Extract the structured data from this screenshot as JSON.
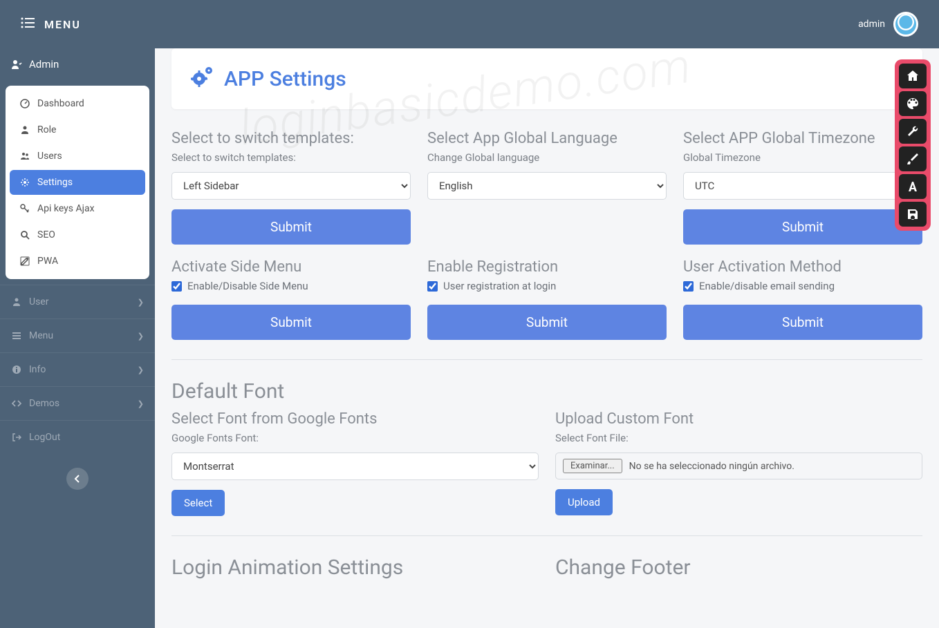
{
  "topbar": {
    "menu_label": "MENU",
    "username": "admin"
  },
  "sidebar": {
    "header": "Admin",
    "admin_items": [
      {
        "icon": "dashboard",
        "label": "Dashboard"
      },
      {
        "icon": "role",
        "label": "Role"
      },
      {
        "icon": "users",
        "label": "Users"
      },
      {
        "icon": "settings",
        "label": "Settings",
        "active": true
      },
      {
        "icon": "key",
        "label": "Api keys Ajax"
      },
      {
        "icon": "search",
        "label": "SEO"
      },
      {
        "icon": "edit",
        "label": "PWA"
      }
    ],
    "sections": [
      {
        "icon": "user",
        "label": "User"
      },
      {
        "icon": "menu",
        "label": "Menu"
      },
      {
        "icon": "info",
        "label": "Info"
      },
      {
        "icon": "code",
        "label": "Demos"
      },
      {
        "icon": "logout",
        "label": "LogOut",
        "no_chev": true
      }
    ]
  },
  "page": {
    "title": "APP Settings"
  },
  "blocks": {
    "template": {
      "title": "Select to switch templates:",
      "sub": "Select to switch templates:",
      "value": "Left Sidebar",
      "submit": "Submit"
    },
    "language": {
      "title": "Select App Global Language",
      "sub": "Change Global language",
      "value": "English"
    },
    "timezone": {
      "title": "Select APP Global Timezone",
      "sub": "Global Timezone",
      "value": "UTC",
      "submit": "Submit"
    },
    "sidemenu": {
      "title": "Activate Side Menu",
      "check": "Enable/Disable Side Menu",
      "submit": "Submit"
    },
    "registration": {
      "title": "Enable Registration",
      "check": "User registration at login",
      "submit": "Submit"
    },
    "activation": {
      "title": "User Activation Method",
      "check": "Enable/disable email sending",
      "submit": "Submit"
    }
  },
  "font_section": {
    "heading": "Default Font",
    "google": {
      "title": "Select Font from Google Fonts",
      "sub": "Google Fonts Font:",
      "value": "Montserrat",
      "btn": "Select"
    },
    "upload": {
      "title": "Upload Custom Font",
      "sub": "Select Font File:",
      "browse": "Examinar...",
      "nofile": "No se ha seleccionado ningún archivo.",
      "btn": "Upload"
    }
  },
  "bottom": {
    "login_anim": "Login Animation Settings",
    "footer": "Change Footer"
  },
  "watermark": "loginbasicdemo.com"
}
